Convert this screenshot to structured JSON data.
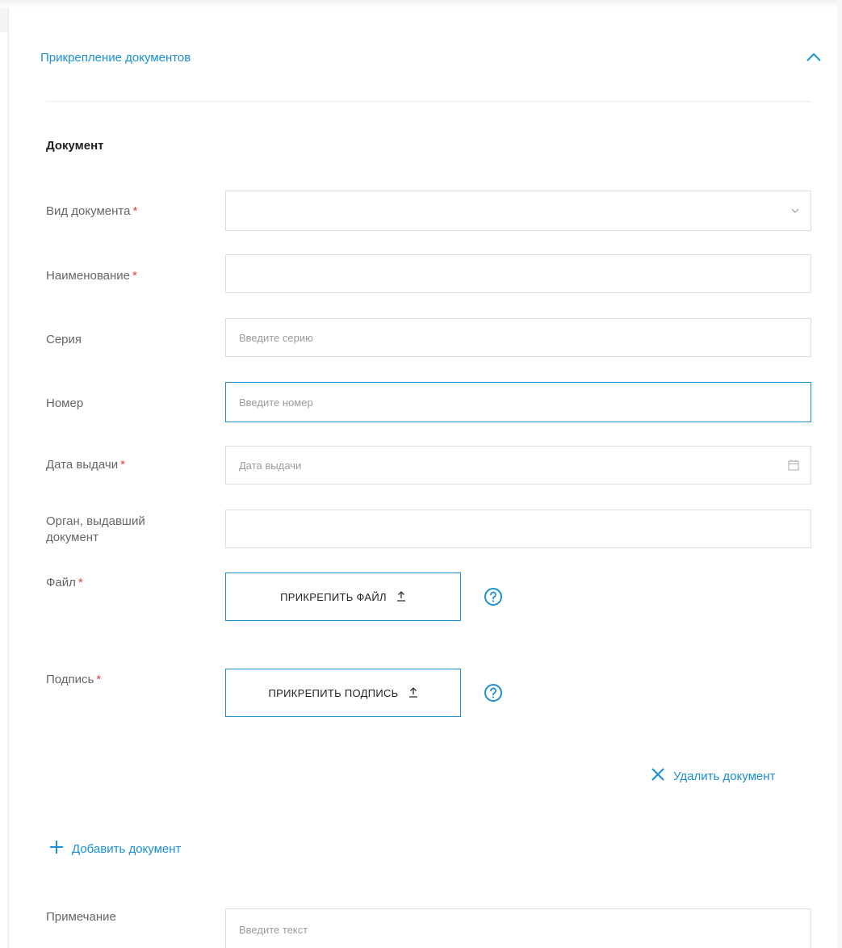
{
  "section": {
    "title": "Прикрепление документов"
  },
  "document": {
    "heading": "Документ",
    "fields": {
      "doc_type": {
        "label": "Вид документа",
        "required_mark": "*",
        "value": ""
      },
      "name": {
        "label": "Наименование",
        "required_mark": "*",
        "value": ""
      },
      "series": {
        "label": "Серия",
        "placeholder": "Введите серию",
        "value": ""
      },
      "number": {
        "label": "Номер",
        "placeholder": "Введите номер",
        "value": ""
      },
      "issue_date": {
        "label": "Дата выдачи",
        "required_mark": "*",
        "placeholder": "Дата выдачи",
        "value": ""
      },
      "issuer": {
        "label_line1": "Орган, выдавший",
        "label_line2": "документ",
        "value": ""
      }
    },
    "file": {
      "label": "Файл",
      "required_mark": "*",
      "button_label": "ПРИКРЕПИТЬ ФАЙЛ"
    },
    "signature": {
      "label": "Подпись",
      "required_mark": "*",
      "button_label": "ПРИКРЕПИТЬ ПОДПИСЬ"
    },
    "delete_label": "Удалить документ"
  },
  "add_document_label": "Добавить документ",
  "note": {
    "label": "Примечание",
    "placeholder": "Введите текст",
    "value": ""
  },
  "colors": {
    "accent": "#1a8fd6",
    "required": "#e0403a",
    "label": "#666666",
    "border": "#dedede"
  },
  "icons": {
    "collapse": "chevron-up-icon",
    "dropdown": "chevron-down-icon",
    "calendar": "calendar-icon",
    "upload": "upload-icon",
    "help": "question-circle-icon",
    "delete": "close-icon",
    "add": "plus-icon"
  }
}
